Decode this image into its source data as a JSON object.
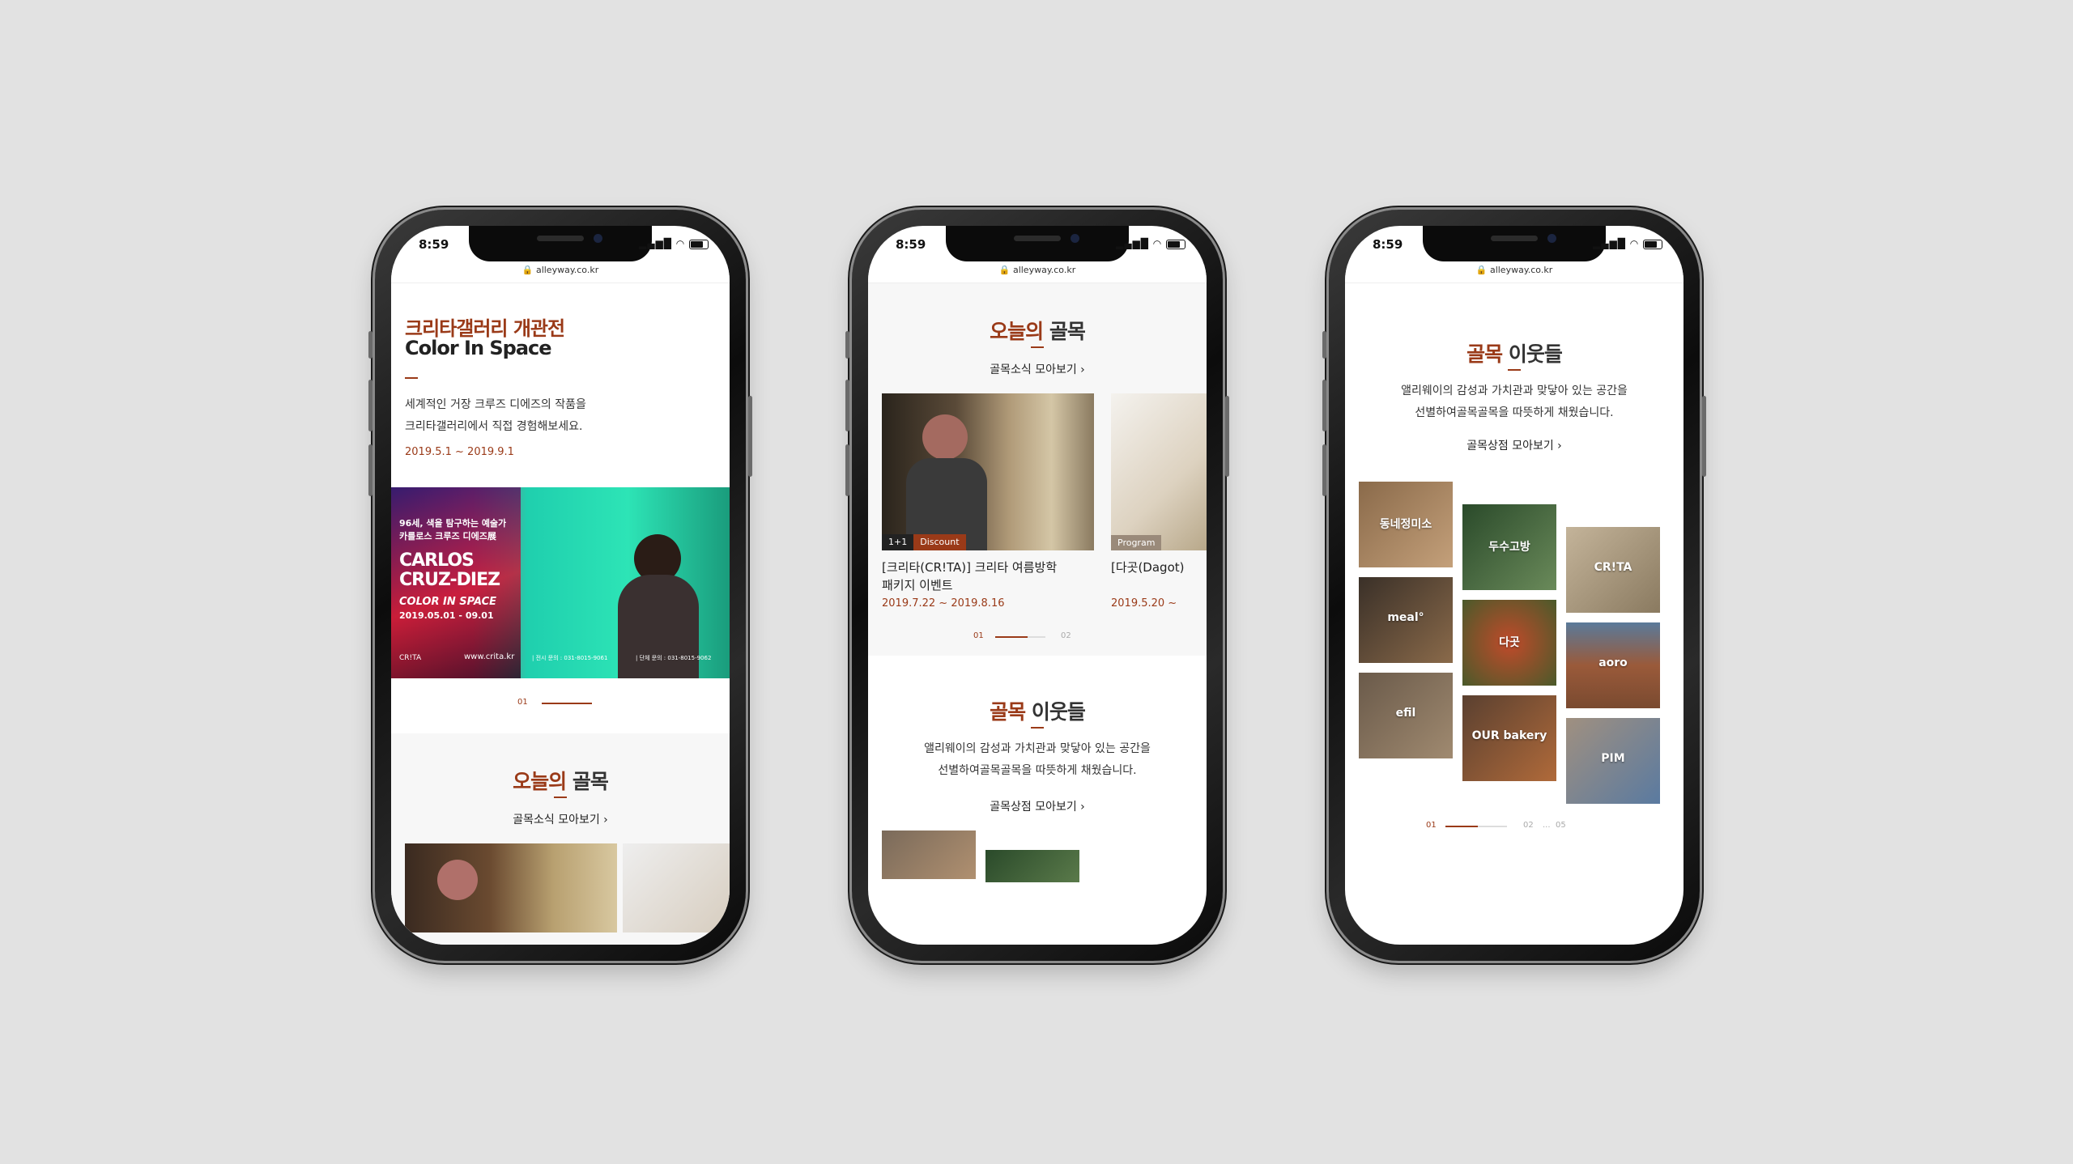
{
  "status": {
    "time": "8:59",
    "url": "alleyway.co.kr"
  },
  "colors": {
    "accent": "#9a3a18",
    "background": "#e2e2e2"
  },
  "phone1": {
    "title_kr": "크리타갤러리 개관전",
    "title_en": "Color In Space",
    "desc_line1": "세계적인 거장 크루즈 디에즈의 작품을",
    "desc_line2": "크리타갤러리에서 직접 경험해보세요.",
    "date": "2019.5.1 ~ 2019.9.1",
    "poster": {
      "kr_line1": "96세, 색을 탐구하는 예술가",
      "kr_line2": "카를로스 크루즈 디에즈展",
      "name1": "CARLOS",
      "name2": "CRUZ-DIEZ",
      "sub": "COLOR IN SPACE",
      "dates": "2019.05.01 - 09.01",
      "brand": "CR!TA",
      "url": "www.crita.kr",
      "contact1": "| 전시 문의 : 031-8015-9061",
      "contact2": "| 단체 문의 : 031-8015-9062"
    },
    "pager": "01",
    "section_title_accent": "오늘의",
    "section_title_rest": " 골목",
    "section_link": "골목소식 모아보기"
  },
  "phone2": {
    "section1_accent": "오늘의",
    "section1_rest": " 골목",
    "section1_link": "골목소식 모아보기",
    "cards": [
      {
        "badge1": "1+1",
        "badge2": "Discount",
        "title_line1": "[크리타(CR!TA)] 크리타 여름방학",
        "title_line2": "패키지 이벤트",
        "date": "2019.7.22 ~ 2019.8.16"
      },
      {
        "badge1": "Program",
        "title_line1": "[다곳(Dagot)",
        "date": "2019.5.20 ~"
      }
    ],
    "pager_current": "01",
    "pager_next": "02",
    "section2_accent": "골목",
    "section2_rest": " 이웃들",
    "desc_line1": "앨리웨이의 감성과 가치관과 맞닿아 있는 공간을",
    "desc_line2": "선별하여골목골목을 따뜻하게 채웠습니다.",
    "section2_link": "골목상점 모아보기"
  },
  "phone3": {
    "section_accent": "골목",
    "section_rest": " 이웃들",
    "desc_line1": "앨리웨이의 감성과 가치관과 맞닿아 있는 공간을",
    "desc_line2": "선별하여골목골목을 따뜻하게 채웠습니다.",
    "link": "골목상점 모아보기",
    "tiles": [
      "동네정미소",
      "meal°",
      "efil",
      "두수고방",
      "다곳",
      "OUR bakery",
      "CR!TA",
      "aoro",
      "PIM"
    ],
    "pager_current": "01",
    "pager_next": "02",
    "pager_ellipsis": "...",
    "pager_last": "05"
  }
}
